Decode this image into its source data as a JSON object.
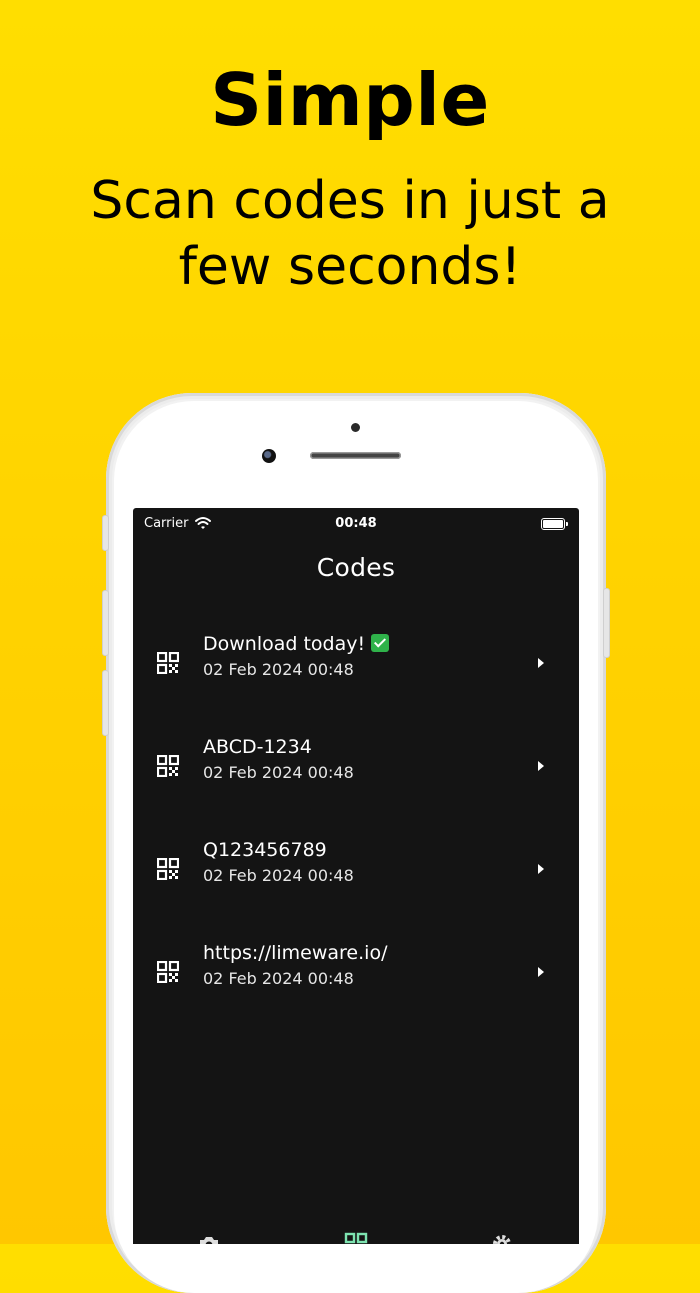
{
  "promo": {
    "headline": "Simple",
    "subhead": "Scan codes in just a few seconds!"
  },
  "status_bar": {
    "carrier": "Carrier",
    "time": "00:48"
  },
  "screen": {
    "title": "Codes",
    "codes": [
      {
        "title": "Download today!",
        "date": "02 Feb 2024 00:48",
        "emoji": "check-mark-icon"
      },
      {
        "title": "ABCD-1234",
        "date": "02 Feb 2024 00:48"
      },
      {
        "title": "Q123456789",
        "date": "02 Feb 2024 00:48"
      },
      {
        "title": "https://limeware.io/",
        "date": "02 Feb 2024 00:48"
      }
    ]
  },
  "tabs": [
    {
      "icon": "camera-icon",
      "active": false
    },
    {
      "icon": "qr-grid-icon",
      "active": true
    },
    {
      "icon": "gear-icon",
      "active": false
    }
  ],
  "colors": {
    "background_top": "#FFDE00",
    "background_bottom": "#FFC700",
    "screen_bg": "#141414",
    "active_tab": "#7DE3B0",
    "check_green": "#2FB24A"
  }
}
